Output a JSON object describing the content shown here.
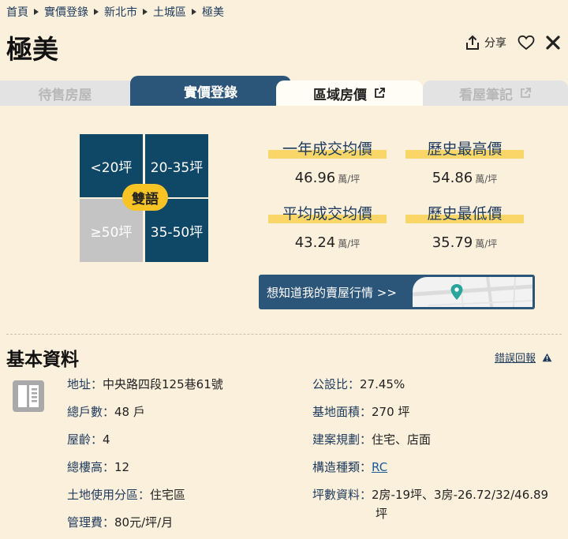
{
  "breadcrumb": [
    "首頁",
    "實價登錄",
    "新北市",
    "土城區",
    "極美"
  ],
  "title": "極美",
  "actions": {
    "share_label": "分享"
  },
  "tabs": [
    {
      "label": "待售房屋"
    },
    {
      "label": "實價登錄"
    },
    {
      "label": "區域房價"
    },
    {
      "label": "看屋筆記"
    }
  ],
  "size_grid": {
    "cells": [
      "<20坪",
      "20-35坪",
      "≥50坪",
      "35-50坪"
    ],
    "badge": "雙語"
  },
  "stats": [
    {
      "label": "一年成交均價",
      "value": "46.96",
      "unit": "萬/坪"
    },
    {
      "label": "歷史最高價",
      "value": "54.86",
      "unit": "萬/坪"
    },
    {
      "label": "平均成交均價",
      "value": "43.24",
      "unit": "萬/坪"
    },
    {
      "label": "歷史最低價",
      "value": "35.79",
      "unit": "萬/坪"
    }
  ],
  "promo": {
    "label": "想知道我的賣屋行情 >>"
  },
  "section": {
    "title": "基本資料",
    "report_label": "錯誤回報"
  },
  "info": {
    "address": {
      "k": "地址：",
      "v": "中央路四段125巷61號"
    },
    "units": {
      "k": "總戶數：",
      "v": "48 戶"
    },
    "age": {
      "k": "屋齡：",
      "v": "4"
    },
    "floors": {
      "k": "總樓高：",
      "v": "12"
    },
    "zoning": {
      "k": "土地使用分區：",
      "v": "住宅區"
    },
    "fee": {
      "k": "管理費：",
      "v": "80元/坪/月"
    },
    "public_ratio": {
      "k": "公設比：",
      "v": "27.45%"
    },
    "land_area": {
      "k": "基地面積：",
      "v": "270 坪"
    },
    "planning": {
      "k": "建案規劃：",
      "v": "住宅、店面"
    },
    "structure": {
      "k": "構造種類：",
      "v": "RC"
    },
    "layout_k": "坪數資料：",
    "layout_l1": "2房-19坪、3房-26.72/32/46.89",
    "layout_l2": "坪"
  },
  "colors": {
    "primary": "#2c5679",
    "accent": "#f7c325",
    "bg": "#fbf0dc"
  }
}
